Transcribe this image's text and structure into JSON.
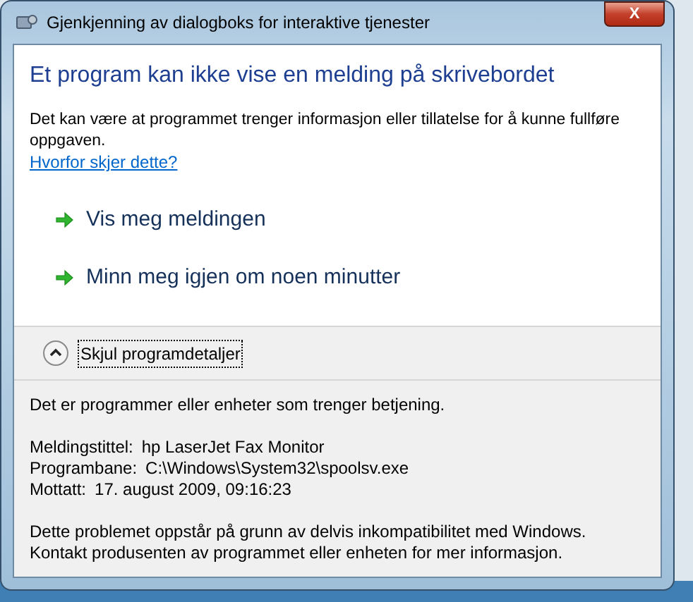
{
  "window": {
    "title": "Gjenkjenning av dialogboks for interaktive tjenester",
    "close": "X"
  },
  "heading": "Et program kan ikke vise en melding på skrivebordet",
  "intro": "Det kan være at programmet trenger informasjon eller tillatelse for å kunne fullføre oppgaven.",
  "link": "Hvorfor skjer dette?",
  "commands": [
    "Vis meg meldingen",
    "Minn meg igjen om noen minutter"
  ],
  "details_toggle": {
    "label": "Skjul programdetaljer",
    "expanded": true
  },
  "details": {
    "summary": "Det er programmer eller enheter som trenger betjening.",
    "fields": [
      {
        "label": "Meldingstittel:",
        "value": "hp LaserJet Fax Monitor"
      },
      {
        "label": "Programbane:",
        "value": "C:\\Windows\\System32\\spoolsv.exe"
      },
      {
        "label": "Mottatt:",
        "value": "17. august 2009, 09:16:23"
      }
    ],
    "note": "Dette problemet oppstår på grunn av delvis inkompatibilitet med Windows. Kontakt produsenten av programmet eller enheten for mer informasjon."
  }
}
